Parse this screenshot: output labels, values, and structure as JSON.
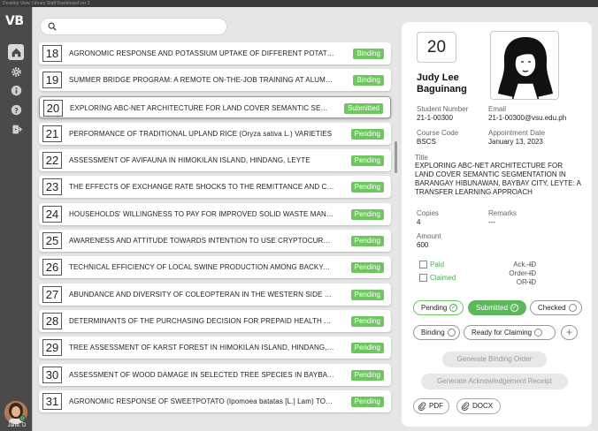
{
  "window": {
    "title": "Desktop View: Library Staff Dashboard ver 2"
  },
  "sidebar": {
    "logo": "VB",
    "nav": [
      "home-icon",
      "gear-icon",
      "info-icon",
      "help-icon",
      "logout-icon"
    ],
    "user_name": "Jane. D"
  },
  "search": {
    "placeholder": "",
    "value": ""
  },
  "list": [
    {
      "num": "18",
      "title": "AGRONOMIC RESPONSE AND POTASSIUM UPTAKE OF DIFFERENT POTATO VARIETIES",
      "status": "Binding"
    },
    {
      "num": "19",
      "title": "SUMMER BRIDGE PROGRAM: A REMOTE ON-THE-JOB TRAINING AT ALUMNI RELATIONS",
      "status": "Binding"
    },
    {
      "num": "20",
      "title": "EXPLORING ABC-NET ARCHITECTURE FOR LAND COVER SEMANTIC SEGMENTATION",
      "status": "Submitted"
    },
    {
      "num": "21",
      "title": "PERFORMANCE OF TRADITIONAL UPLAND RICE (Oryza sativa L.) VARIETIES",
      "status": "Pending"
    },
    {
      "num": "22",
      "title": "ASSESSMENT OF AVIFAUNA IN HIMOKILAN ISLAND, HINDANG, LEYTE",
      "status": "Pending"
    },
    {
      "num": "23",
      "title": "THE EFFECTS OF EXCHANGE RATE SHOCKS TO THE REMITTANCE AND CONSUMPTION",
      "status": "Pending"
    },
    {
      "num": "24",
      "title": "HOUSEHOLDS' WILLINGNESS TO PAY FOR IMPROVED SOLID WASTE MANAGEMENT",
      "status": "Pending"
    },
    {
      "num": "25",
      "title": "AWARENESS AND ATTITUDE TOWARDS INTENTION TO USE CRYPTOCURRENCY",
      "status": "Pending"
    },
    {
      "num": "26",
      "title": "TECHNICAL EFFICIENCY OF LOCAL SWINE PRODUCTION AMONG BACKYARD FARMERS",
      "status": "Pending"
    },
    {
      "num": "27",
      "title": "ABUNDANCE AND DIVERSITY OF COLEOPTERAN IN THE WESTERN SIDE OF MT. PANGASUGAN",
      "status": "Pending"
    },
    {
      "num": "28",
      "title": "DETERMINANTS OF THE PURCHASING DECISION FOR PREPAID HEALTH CARD",
      "status": "Pending"
    },
    {
      "num": "29",
      "title": "TREE ASSESSMENT OF KARST FOREST IN HIMOKILAN ISLAND, HINDANG, LEYTE",
      "status": "Pending"
    },
    {
      "num": "30",
      "title": "ASSESSMENT OF WOOD DAMAGE IN SELECTED TREE SPECIES IN BAYBAY CITY",
      "status": "Pending"
    },
    {
      "num": "31",
      "title": "AGRONOMIC RESPONSE OF SWEETPOTATO (Ipomoea batatas [L.] Lam) TO FERTILIZER",
      "status": "Pending"
    }
  ],
  "detail": {
    "number": "20",
    "name": "Judy Lee Baguinang",
    "student_number_label": "Student Number",
    "student_number": "21-1-00300",
    "email_label": "Email",
    "email": "21-1-00300@vsu.edu.ph",
    "course_label": "Course Code",
    "course": "BSCS",
    "appointment_label": "Appointment Date",
    "appointment": "January 13, 2023",
    "title_label": "Title",
    "title": "EXPLORING ABC-NET ARCHITECTURE FOR LAND COVER SEMANTIC SEGMENTATION IN BARANGAY HIBUNAWAN, BAYBAY CITY, LEYTE: A TRANSFER LEARNING APPROACH",
    "copies_label": "Copies",
    "copies": "4",
    "remarks_label": "Remarks",
    "remarks": "---",
    "amount_label": "Amount",
    "amount": "600",
    "paid_label": "Paid",
    "claimed_label": "Claimed",
    "ack_id_label": "Ack. ID",
    "ack_id": "---",
    "order_id_label": "Order ID",
    "order_id": "---",
    "or_id_label": "OR ID",
    "or_id": "---"
  },
  "status_buttons": {
    "pending": "Pending",
    "submitted": "Submitted",
    "checked": "Checked",
    "binding": "Binding",
    "ready": "Ready for Claiming",
    "add": "+"
  },
  "actions": {
    "binding_order": "Generate Binding Order",
    "ack_receipt": "Generate Acknowledgement Receipt",
    "pdf": "PDF",
    "docx": "DOCX"
  },
  "colors": {
    "accent_green": "#6cc75c",
    "sidebar": "#4a4a4a",
    "background": "#e6e6e6"
  }
}
